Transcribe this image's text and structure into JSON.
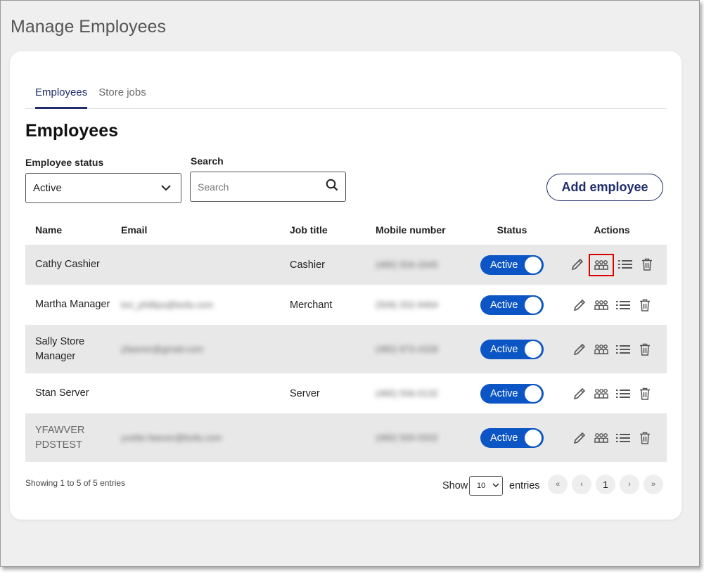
{
  "page": {
    "title": "Manage Employees"
  },
  "tabs": [
    {
      "label": "Employees",
      "active": true
    },
    {
      "label": "Store jobs",
      "active": false
    }
  ],
  "section": {
    "title": "Employees"
  },
  "filters": {
    "status_label": "Employee status",
    "status_value": "Active",
    "search_label": "Search",
    "search_placeholder": "Search"
  },
  "actions": {
    "add_label": "Add employee"
  },
  "table": {
    "headers": {
      "name": "Name",
      "email": "Email",
      "job": "Job title",
      "mobile": "Mobile number",
      "status": "Status",
      "actions": "Actions"
    },
    "rows": [
      {
        "name": "Cathy Cashier",
        "email": "",
        "job": "Cashier",
        "mobile": "(480) 504-3345",
        "status": "Active"
      },
      {
        "name": "Martha Manager",
        "email": "lori_phillips@bofa.com",
        "job": "Merchant",
        "mobile": "(509) 202-9464",
        "status": "Active"
      },
      {
        "name": "Sally Store Manager",
        "email": "yfawver@gmail.com",
        "job": "",
        "mobile": "(480) 973-4328",
        "status": "Active"
      },
      {
        "name": "Stan Server",
        "email": "",
        "job": "Server",
        "mobile": "(480) 556-0132",
        "status": "Active"
      },
      {
        "name": "YFAWVER PDSTEST",
        "email": "yvette.fawver@bofa.com",
        "job": "",
        "mobile": "(480) 500-5502",
        "status": "Active"
      }
    ],
    "action_icons": [
      "pencil-icon",
      "people-group-icon",
      "list-icon",
      "trash-icon"
    ]
  },
  "footer": {
    "info": "Showing 1 to 5 of 5 entries",
    "show_label": "Show",
    "page_size": "10",
    "entries_label": "entries",
    "pager": {
      "first": "«",
      "prev": "‹",
      "current": "1",
      "next": "›",
      "last": "»"
    }
  },
  "colors": {
    "accent": "#1f2e6b",
    "toggle": "#0b55c4",
    "highlight": "#d90000"
  }
}
